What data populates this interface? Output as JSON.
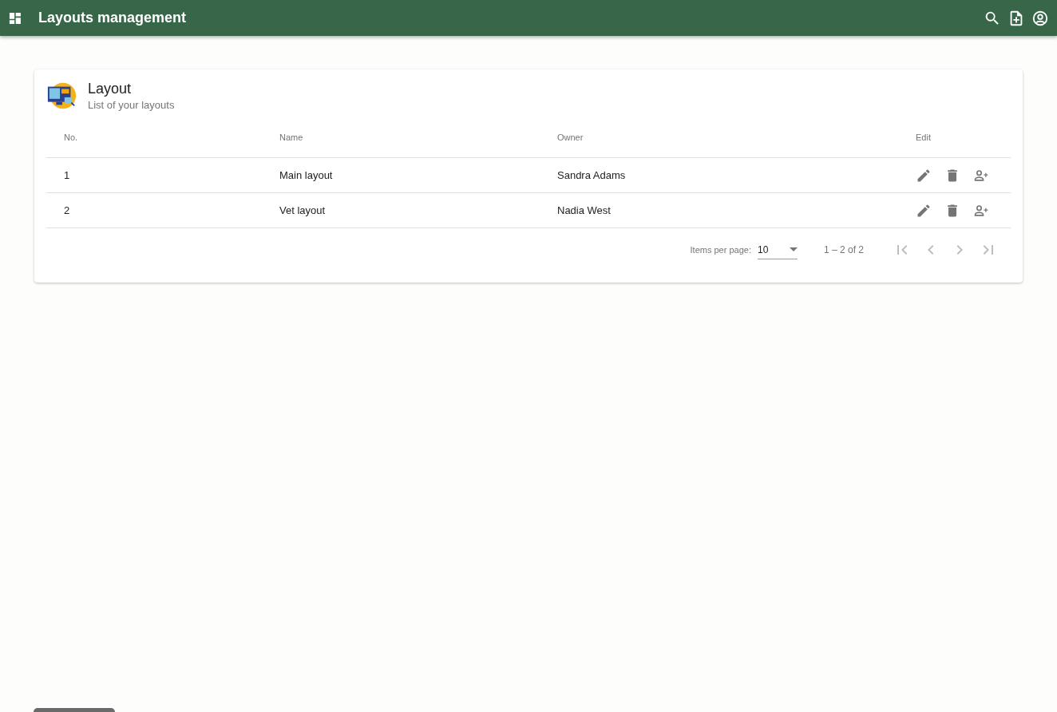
{
  "app_bar": {
    "title": "Layouts management"
  },
  "card": {
    "title": "Layout",
    "subtitle": "List of your layouts"
  },
  "table": {
    "columns": [
      "No.",
      "Name",
      "Owner",
      "Edit"
    ],
    "rows": [
      {
        "no": "1",
        "name": "Main layout",
        "owner": "Sandra Adams"
      },
      {
        "no": "2",
        "name": "Vet layout",
        "owner": "Nadia West"
      }
    ]
  },
  "paginator": {
    "items_per_page_label": "Items per page:",
    "page_size": "10",
    "range": "1 – 2 of 2",
    "buttons": [
      {
        "kind": "first",
        "disabled": true
      },
      {
        "kind": "prev",
        "disabled": true
      },
      {
        "kind": "next",
        "disabled": true
      },
      {
        "kind": "last",
        "disabled": true
      }
    ]
  }
}
